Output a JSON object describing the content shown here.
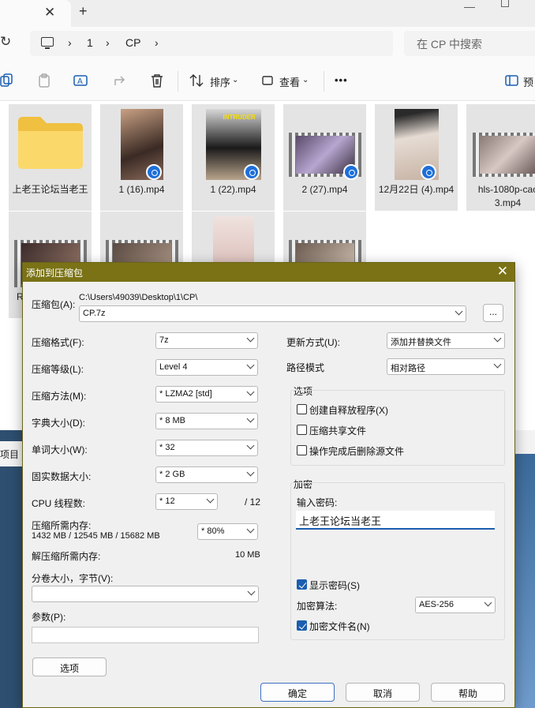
{
  "explorer": {
    "tab_new": "+",
    "breadcrumbs": [
      "1",
      "CP"
    ],
    "search_placeholder": "在 CP 中搜索",
    "commands": {
      "sort_label": "排序",
      "view_label": "查看",
      "more_label": "•••",
      "preview_label": "预"
    },
    "files": [
      {
        "name": "上老王论坛当老王",
        "type": "folder"
      },
      {
        "name": "1 (16).mp4",
        "type": "video"
      },
      {
        "name": "1 (22).mp4",
        "type": "video",
        "overlay_text": "INTRUDER"
      },
      {
        "name": "2 (27).mp4",
        "type": "video"
      },
      {
        "name": "12月22日 (4).mp4",
        "type": "video"
      },
      {
        "name": "hls-1080p-cac 3.mp4",
        "type": "video"
      },
      {
        "name": "R",
        "type": "video"
      },
      {
        "name": "",
        "type": "video"
      },
      {
        "name": "",
        "type": "video"
      },
      {
        "name": "",
        "type": "video"
      }
    ],
    "side_label": "项目"
  },
  "dialog": {
    "title": "添加到压缩包",
    "archive_label": "压缩包(A):",
    "archive_path": "C:\\Users\\49039\\Desktop\\1\\CP\\",
    "archive_name": "CP.7z",
    "browse_label": "...",
    "format_label": "压缩格式(F):",
    "format_value": "7z",
    "level_label": "压缩等级(L):",
    "level_value": "Level 4",
    "method_label": "压缩方法(M):",
    "method_value": "*  LZMA2 [std]",
    "dict_label": "字典大小(D):",
    "dict_value": "*  8 MB",
    "word_label": "单词大小(W):",
    "word_value": "*  32",
    "solid_label": "固实数据大小:",
    "solid_value": "*  2 GB",
    "cpu_label": "CPU 线程数:",
    "cpu_value": "*  12",
    "cpu_total": "/ 12",
    "mem_label": "压缩所需内存:",
    "mem_value": "1432 MB / 12545 MB / 15682 MB",
    "mem_percent": "* 80%",
    "decomp_label": "解压缩所需内存:",
    "decomp_value": "10 MB",
    "split_label": "分卷大小，字节(V):",
    "split_value": "",
    "params_label": "参数(P):",
    "params_value": "",
    "options_button": "选项",
    "update_label": "更新方式(U):",
    "update_value": "添加并替换文件",
    "pathmode_label": "路径模式",
    "pathmode_value": "相对路径",
    "options_group": "选项",
    "opt_sfx": "创建自释放程序(X)",
    "opt_shared": "压缩共享文件",
    "opt_delete": "操作完成后删除源文件",
    "encrypt_group": "加密",
    "password_label": "输入密码:",
    "password_value": "上老王论坛当老王",
    "show_password": "显示密码(S)",
    "enc_method_label": "加密算法:",
    "enc_method_value": "AES-256",
    "enc_names": "加密文件名(N)",
    "ok": "确定",
    "cancel": "取消",
    "help": "帮助"
  }
}
